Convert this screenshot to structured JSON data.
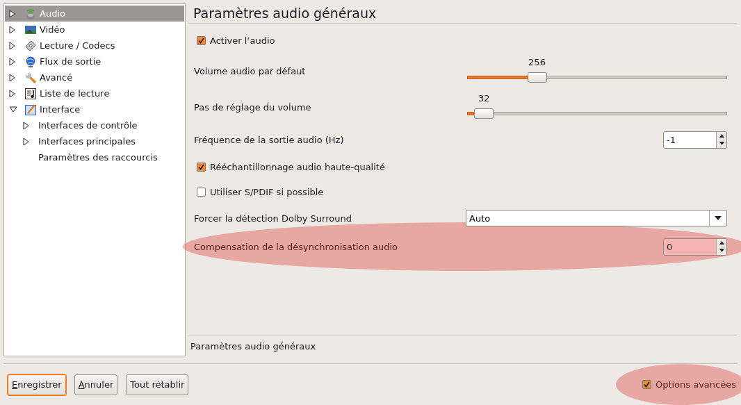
{
  "tree": [
    {
      "label": "Audio",
      "selected": true,
      "kind": "branch",
      "expanded": false
    },
    {
      "label": "Vidéo",
      "selected": false,
      "kind": "branch",
      "expanded": false
    },
    {
      "label": "Lecture / Codecs",
      "selected": false,
      "kind": "branch",
      "expanded": false
    },
    {
      "label": "Flux de sortie",
      "selected": false,
      "kind": "branch",
      "expanded": false
    },
    {
      "label": "Avancé",
      "selected": false,
      "kind": "branch",
      "expanded": false
    },
    {
      "label": "Liste de lecture",
      "selected": false,
      "kind": "branch",
      "expanded": false
    },
    {
      "label": "Interface",
      "selected": false,
      "kind": "branch",
      "expanded": true,
      "children": [
        {
          "label": "Interfaces de contrôle",
          "selected": false,
          "kind": "branch",
          "expanded": false
        },
        {
          "label": "Interfaces principales",
          "selected": false,
          "kind": "branch",
          "expanded": false
        },
        {
          "label": "Paramètres des raccourcis",
          "selected": false,
          "kind": "leaf"
        }
      ]
    }
  ],
  "panel": {
    "title": "Paramètres audio généraux",
    "settings": [
      {
        "kind": "checkbox",
        "label": "Activer l’audio",
        "checked": true,
        "highlighted": false
      },
      {
        "kind": "slider",
        "label": "Volume audio par défaut",
        "reading": "256",
        "level": 0.25,
        "highlighted": false
      },
      {
        "kind": "slider",
        "label": "Pas de réglage du volume",
        "reading": "32",
        "level": 0.03,
        "highlighted": false
      },
      {
        "kind": "spin",
        "label": "Fréquence de la sortie audio (Hz)",
        "value": "-1",
        "highlighted": false
      },
      {
        "kind": "checkbox",
        "label": "Rééchantillonnage audio haute-qualité",
        "checked": true,
        "highlighted": false
      },
      {
        "kind": "checkbox",
        "label": "Utiliser S/PDIF si possible",
        "checked": false,
        "highlighted": false
      },
      {
        "kind": "select",
        "label": "Forcer la détection Dolby Surround",
        "value": "Auto",
        "highlighted": false
      },
      {
        "kind": "spin",
        "label": "Compensation de la désynchronisation audio",
        "value": "0",
        "highlighted": true
      }
    ],
    "description": "Paramètres audio généraux"
  },
  "buttons": [
    {
      "label": "Enregistrer",
      "mnemonic_underlined": true,
      "focused": true
    },
    {
      "label": "Annuler",
      "mnemonic_underlined": true,
      "focused": false
    },
    {
      "label": "Tout rétablir",
      "mnemonic_underlined": false,
      "focused": false
    }
  ],
  "advanced": {
    "label": "Options avancées",
    "checked": true,
    "highlighted": true
  }
}
